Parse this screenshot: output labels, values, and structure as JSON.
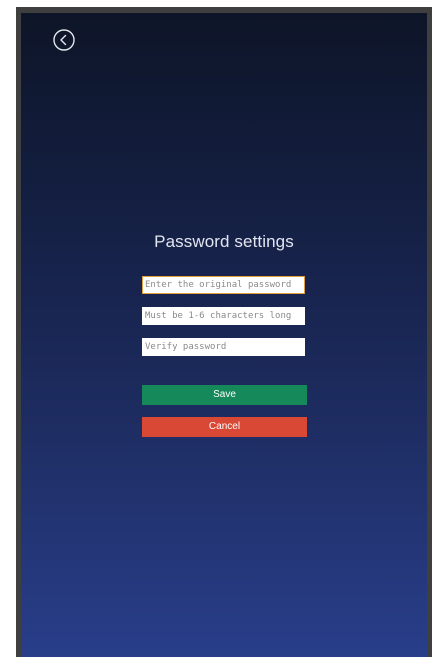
{
  "header": {
    "back_icon": "chevron-left-circle-icon"
  },
  "form": {
    "title": "Password settings",
    "original_password": {
      "placeholder": "Enter the original password",
      "value": ""
    },
    "new_password": {
      "placeholder": "Must be 1-6 characters long",
      "value": ""
    },
    "verify_password": {
      "placeholder": "Verify password",
      "value": ""
    },
    "save_label": "Save",
    "cancel_label": "Cancel"
  },
  "colors": {
    "save": "#16895a",
    "cancel": "#d94834",
    "focus_border": "#e0a040",
    "background_top": "#0e1528",
    "background_bottom": "#293e8a"
  }
}
